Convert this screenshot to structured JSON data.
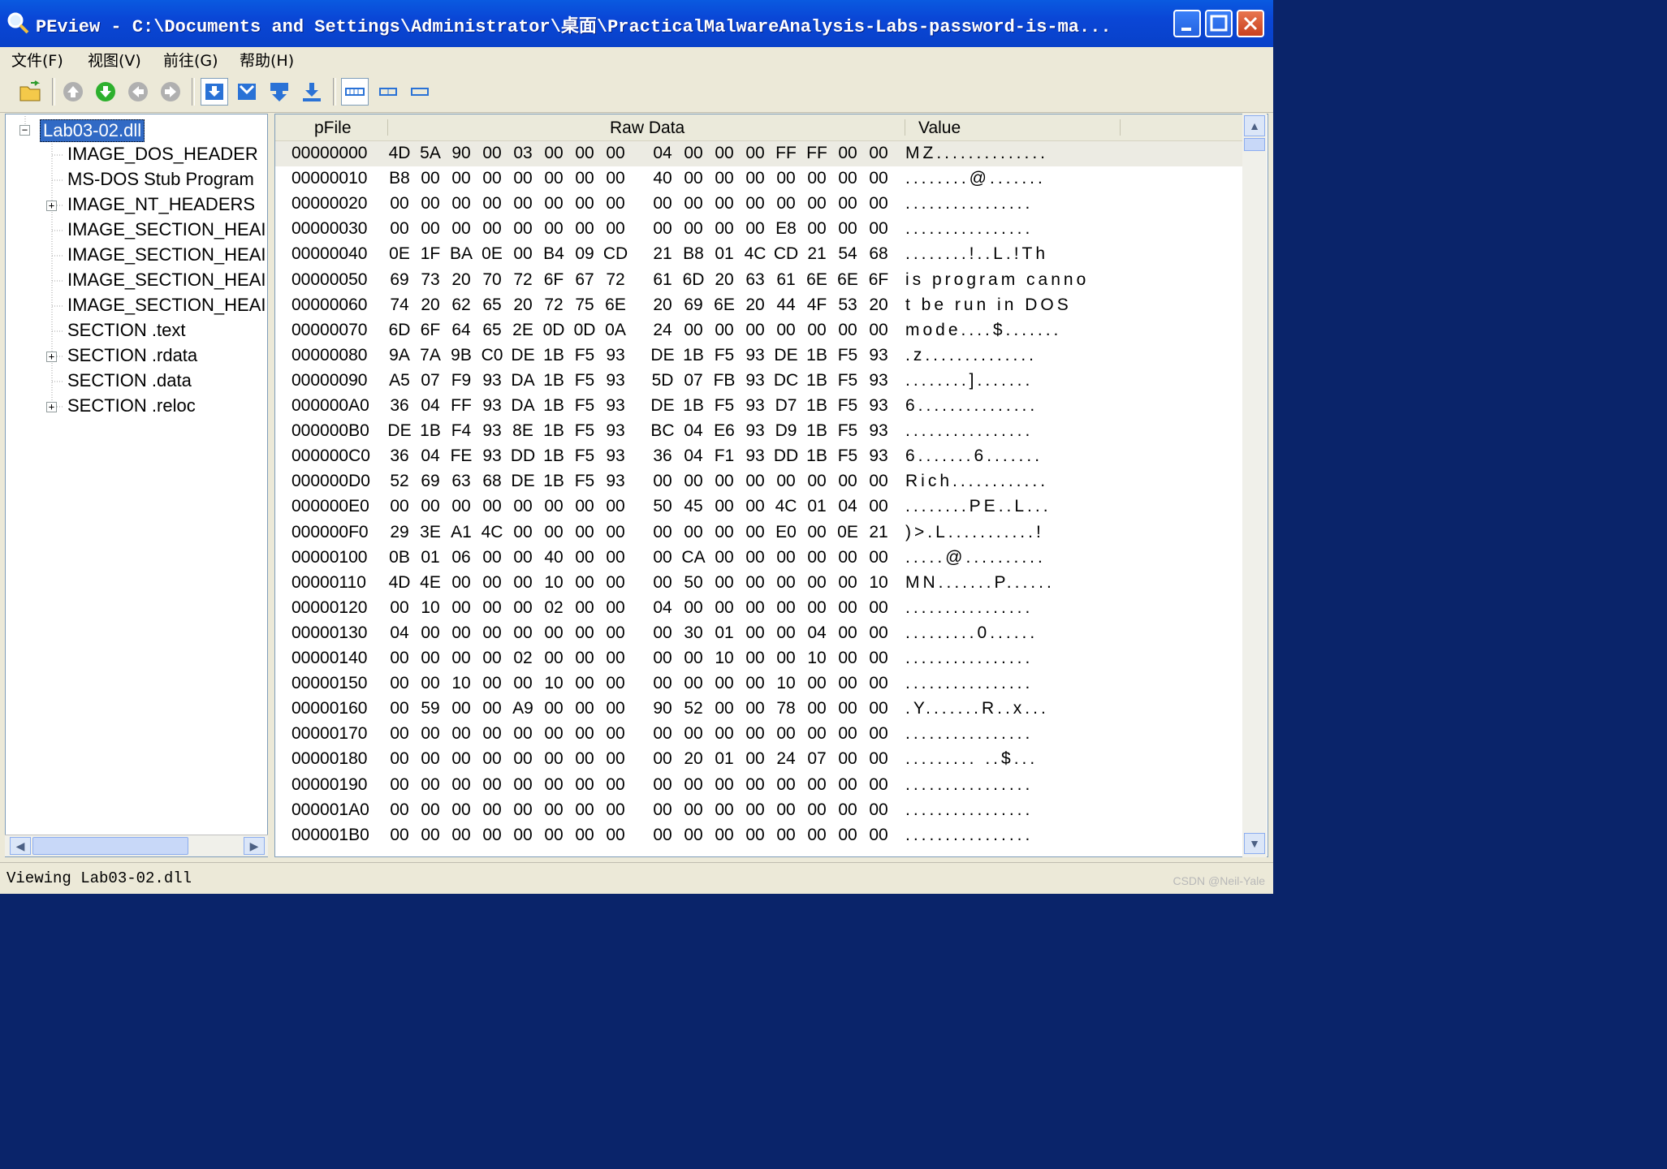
{
  "window": {
    "title": "PEview - C:\\Documents and Settings\\Administrator\\桌面\\PracticalMalwareAnalysis-Labs-password-is-ma..."
  },
  "menu": [
    "文件(F)",
    "视图(V)",
    "前往(G)",
    "帮助(H)"
  ],
  "toolbar": [
    "open-icon",
    "up-icon",
    "down-icon",
    "back-icon",
    "forward-icon",
    "view-byte-icon",
    "view-word-icon",
    "view-dword-icon",
    "view-qword-icon",
    "wide-view-icon",
    "narrow-view-icon",
    "minimal-view-icon"
  ],
  "tree": [
    {
      "label": "Lab03-02.dll",
      "expander": "⊟",
      "selected": true
    },
    {
      "label": "IMAGE_DOS_HEADER"
    },
    {
      "label": "MS-DOS Stub Program"
    },
    {
      "label": "IMAGE_NT_HEADERS",
      "expander": "+"
    },
    {
      "label": "IMAGE_SECTION_HEAI"
    },
    {
      "label": "IMAGE_SECTION_HEAI"
    },
    {
      "label": "IMAGE_SECTION_HEAI"
    },
    {
      "label": "IMAGE_SECTION_HEAI"
    },
    {
      "label": "SECTION .text"
    },
    {
      "label": "SECTION .rdata",
      "expander": "+"
    },
    {
      "label": "SECTION .data"
    },
    {
      "label": "SECTION .reloc",
      "expander": "+"
    }
  ],
  "columns": {
    "pfile": "pFile",
    "raw": "Raw Data",
    "value": "Value"
  },
  "rows": [
    {
      "addr": "00000000",
      "bytes": [
        "4D",
        "5A",
        "90",
        "00",
        "03",
        "00",
        "00",
        "00",
        "04",
        "00",
        "00",
        "00",
        "FF",
        "FF",
        "00",
        "00"
      ],
      "value": "MZ.............."
    },
    {
      "addr": "00000010",
      "bytes": [
        "B8",
        "00",
        "00",
        "00",
        "00",
        "00",
        "00",
        "00",
        "40",
        "00",
        "00",
        "00",
        "00",
        "00",
        "00",
        "00"
      ],
      "value": "........@......."
    },
    {
      "addr": "00000020",
      "bytes": [
        "00",
        "00",
        "00",
        "00",
        "00",
        "00",
        "00",
        "00",
        "00",
        "00",
        "00",
        "00",
        "00",
        "00",
        "00",
        "00"
      ],
      "value": "................"
    },
    {
      "addr": "00000030",
      "bytes": [
        "00",
        "00",
        "00",
        "00",
        "00",
        "00",
        "00",
        "00",
        "00",
        "00",
        "00",
        "00",
        "E8",
        "00",
        "00",
        "00"
      ],
      "value": "................"
    },
    {
      "addr": "00000040",
      "bytes": [
        "0E",
        "1F",
        "BA",
        "0E",
        "00",
        "B4",
        "09",
        "CD",
        "21",
        "B8",
        "01",
        "4C",
        "CD",
        "21",
        "54",
        "68"
      ],
      "value": "........!..L.!Th"
    },
    {
      "addr": "00000050",
      "bytes": [
        "69",
        "73",
        "20",
        "70",
        "72",
        "6F",
        "67",
        "72",
        "61",
        "6D",
        "20",
        "63",
        "61",
        "6E",
        "6E",
        "6F"
      ],
      "value": "is program canno"
    },
    {
      "addr": "00000060",
      "bytes": [
        "74",
        "20",
        "62",
        "65",
        "20",
        "72",
        "75",
        "6E",
        "20",
        "69",
        "6E",
        "20",
        "44",
        "4F",
        "53",
        "20"
      ],
      "value": "t be run in DOS "
    },
    {
      "addr": "00000070",
      "bytes": [
        "6D",
        "6F",
        "64",
        "65",
        "2E",
        "0D",
        "0D",
        "0A",
        "24",
        "00",
        "00",
        "00",
        "00",
        "00",
        "00",
        "00"
      ],
      "value": "mode....$......."
    },
    {
      "addr": "00000080",
      "bytes": [
        "9A",
        "7A",
        "9B",
        "C0",
        "DE",
        "1B",
        "F5",
        "93",
        "DE",
        "1B",
        "F5",
        "93",
        "DE",
        "1B",
        "F5",
        "93"
      ],
      "value": ".z.............."
    },
    {
      "addr": "00000090",
      "bytes": [
        "A5",
        "07",
        "F9",
        "93",
        "DA",
        "1B",
        "F5",
        "93",
        "5D",
        "07",
        "FB",
        "93",
        "DC",
        "1B",
        "F5",
        "93"
      ],
      "value": "........]......."
    },
    {
      "addr": "000000A0",
      "bytes": [
        "36",
        "04",
        "FF",
        "93",
        "DA",
        "1B",
        "F5",
        "93",
        "DE",
        "1B",
        "F5",
        "93",
        "D7",
        "1B",
        "F5",
        "93"
      ],
      "value": "6..............."
    },
    {
      "addr": "000000B0",
      "bytes": [
        "DE",
        "1B",
        "F4",
        "93",
        "8E",
        "1B",
        "F5",
        "93",
        "BC",
        "04",
        "E6",
        "93",
        "D9",
        "1B",
        "F5",
        "93"
      ],
      "value": "................"
    },
    {
      "addr": "000000C0",
      "bytes": [
        "36",
        "04",
        "FE",
        "93",
        "DD",
        "1B",
        "F5",
        "93",
        "36",
        "04",
        "F1",
        "93",
        "DD",
        "1B",
        "F5",
        "93"
      ],
      "value": "6.......6......."
    },
    {
      "addr": "000000D0",
      "bytes": [
        "52",
        "69",
        "63",
        "68",
        "DE",
        "1B",
        "F5",
        "93",
        "00",
        "00",
        "00",
        "00",
        "00",
        "00",
        "00",
        "00"
      ],
      "value": "Rich............"
    },
    {
      "addr": "000000E0",
      "bytes": [
        "00",
        "00",
        "00",
        "00",
        "00",
        "00",
        "00",
        "00",
        "50",
        "45",
        "00",
        "00",
        "4C",
        "01",
        "04",
        "00"
      ],
      "value": "........PE..L..."
    },
    {
      "addr": "000000F0",
      "bytes": [
        "29",
        "3E",
        "A1",
        "4C",
        "00",
        "00",
        "00",
        "00",
        "00",
        "00",
        "00",
        "00",
        "E0",
        "00",
        "0E",
        "21"
      ],
      "value": ")>.L...........!"
    },
    {
      "addr": "00000100",
      "bytes": [
        "0B",
        "01",
        "06",
        "00",
        "00",
        "40",
        "00",
        "00",
        "00",
        "CA",
        "00",
        "00",
        "00",
        "00",
        "00",
        "00"
      ],
      "value": ".....@.........."
    },
    {
      "addr": "00000110",
      "bytes": [
        "4D",
        "4E",
        "00",
        "00",
        "00",
        "10",
        "00",
        "00",
        "00",
        "50",
        "00",
        "00",
        "00",
        "00",
        "00",
        "10"
      ],
      "value": "MN.......P......"
    },
    {
      "addr": "00000120",
      "bytes": [
        "00",
        "10",
        "00",
        "00",
        "00",
        "02",
        "00",
        "00",
        "04",
        "00",
        "00",
        "00",
        "00",
        "00",
        "00",
        "00"
      ],
      "value": "................"
    },
    {
      "addr": "00000130",
      "bytes": [
        "04",
        "00",
        "00",
        "00",
        "00",
        "00",
        "00",
        "00",
        "00",
        "30",
        "01",
        "00",
        "00",
        "04",
        "00",
        "00"
      ],
      "value": ".........0......"
    },
    {
      "addr": "00000140",
      "bytes": [
        "00",
        "00",
        "00",
        "00",
        "02",
        "00",
        "00",
        "00",
        "00",
        "00",
        "10",
        "00",
        "00",
        "10",
        "00",
        "00"
      ],
      "value": "................"
    },
    {
      "addr": "00000150",
      "bytes": [
        "00",
        "00",
        "10",
        "00",
        "00",
        "10",
        "00",
        "00",
        "00",
        "00",
        "00",
        "00",
        "10",
        "00",
        "00",
        "00"
      ],
      "value": "................"
    },
    {
      "addr": "00000160",
      "bytes": [
        "00",
        "59",
        "00",
        "00",
        "A9",
        "00",
        "00",
        "00",
        "90",
        "52",
        "00",
        "00",
        "78",
        "00",
        "00",
        "00"
      ],
      "value": ".Y.......R..x..."
    },
    {
      "addr": "00000170",
      "bytes": [
        "00",
        "00",
        "00",
        "00",
        "00",
        "00",
        "00",
        "00",
        "00",
        "00",
        "00",
        "00",
        "00",
        "00",
        "00",
        "00"
      ],
      "value": "................"
    },
    {
      "addr": "00000180",
      "bytes": [
        "00",
        "00",
        "00",
        "00",
        "00",
        "00",
        "00",
        "00",
        "00",
        "20",
        "01",
        "00",
        "24",
        "07",
        "00",
        "00"
      ],
      "value": "......... ..$..."
    },
    {
      "addr": "00000190",
      "bytes": [
        "00",
        "00",
        "00",
        "00",
        "00",
        "00",
        "00",
        "00",
        "00",
        "00",
        "00",
        "00",
        "00",
        "00",
        "00",
        "00"
      ],
      "value": "................"
    },
    {
      "addr": "000001A0",
      "bytes": [
        "00",
        "00",
        "00",
        "00",
        "00",
        "00",
        "00",
        "00",
        "00",
        "00",
        "00",
        "00",
        "00",
        "00",
        "00",
        "00"
      ],
      "value": "................"
    },
    {
      "addr": "000001B0",
      "bytes": [
        "00",
        "00",
        "00",
        "00",
        "00",
        "00",
        "00",
        "00",
        "00",
        "00",
        "00",
        "00",
        "00",
        "00",
        "00",
        "00"
      ],
      "value": "................"
    }
  ],
  "status": "Viewing Lab03-02.dll",
  "watermark": "CSDN @Neil-Yale",
  "colors": {
    "title_bar": "#0a46d6",
    "selection": "#316ac5",
    "window_bg": "#ece9d8"
  }
}
